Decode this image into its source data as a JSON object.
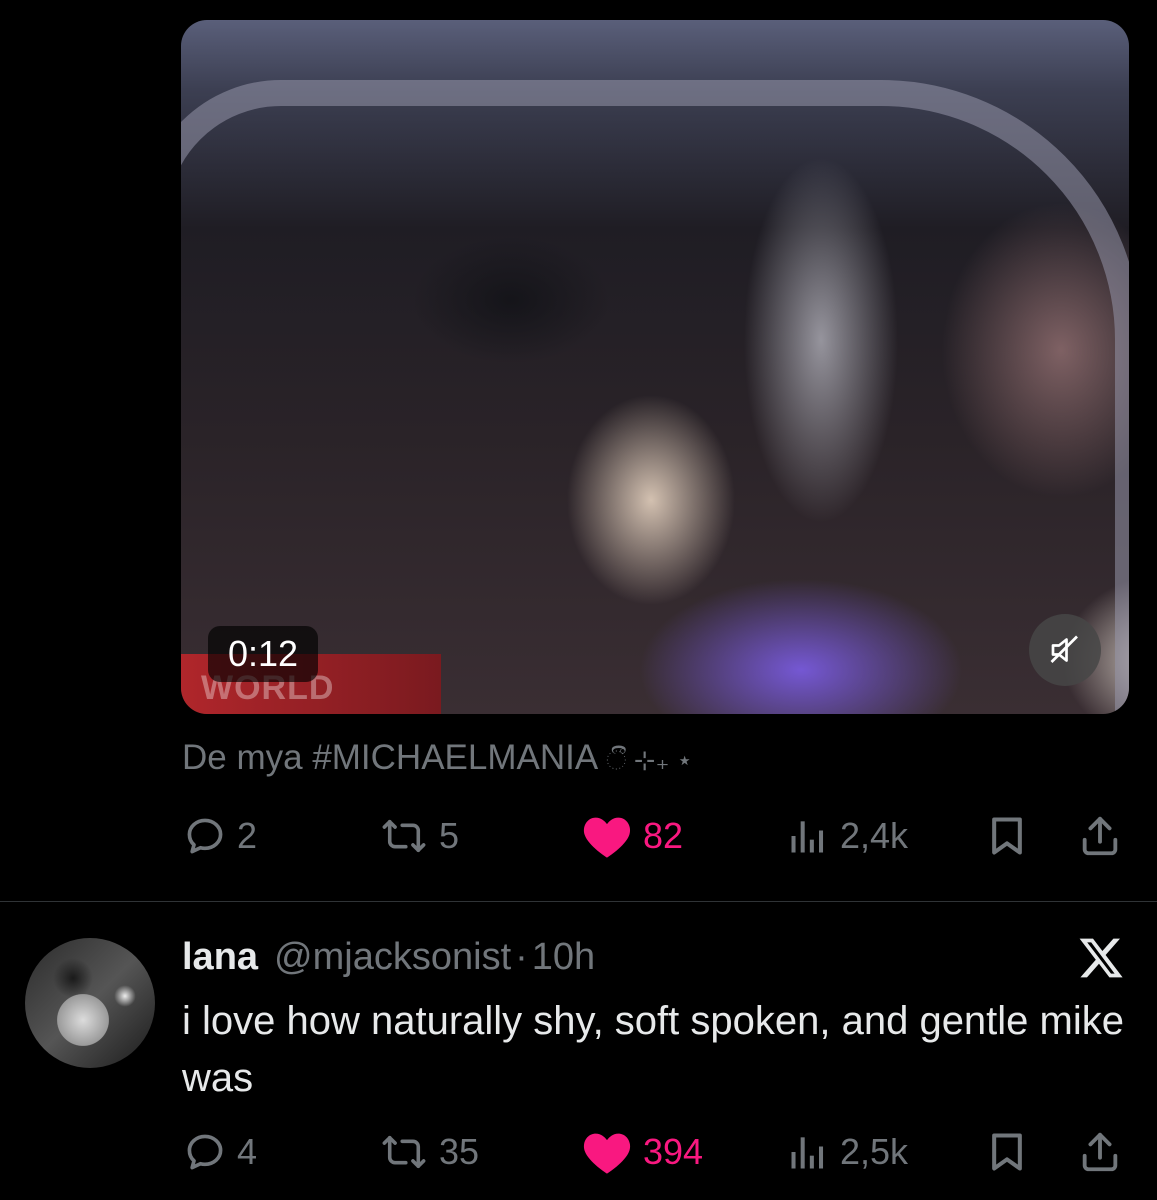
{
  "video": {
    "duration": "0:12",
    "banner_text": "WORLD",
    "muted_icon": "speaker-muted-icon"
  },
  "caption": {
    "text": "De mya ",
    "hashtag": "#MICHAELMANIA",
    "decoration": "ී ⊹₊ ⋆"
  },
  "first_tweet_actions": {
    "replies": "2",
    "reposts": "5",
    "likes": "82",
    "views": "2,4k"
  },
  "reply_tweet": {
    "display_name": "lana",
    "handle": "@mjacksonist",
    "separator": "·",
    "time": "10h",
    "text": "i love how naturally shy, soft spoken, and gentle mike was",
    "actions": {
      "replies": "4",
      "reposts": "35",
      "likes": "394",
      "views": "2,5k"
    }
  },
  "colors": {
    "background": "#000000",
    "text_primary": "#e7e9ea",
    "text_secondary": "#71767b",
    "like_pink": "#f91880",
    "divider": "#2f3336"
  },
  "icons": [
    "reply-icon",
    "repost-icon",
    "heart-icon",
    "views-icon",
    "bookmark-icon",
    "share-icon",
    "x-logo-icon"
  ]
}
